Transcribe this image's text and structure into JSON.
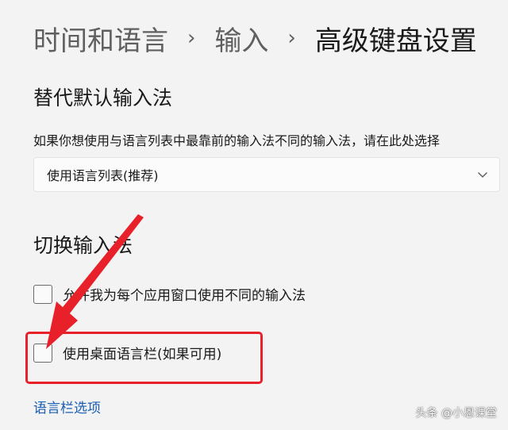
{
  "breadcrumb": {
    "items": [
      "时间和语言",
      "输入",
      "高级键盘设置"
    ],
    "separator": "›"
  },
  "override_section": {
    "title": "替代默认输入法",
    "description": "如果你想使用与语言列表中最靠前的输入法不同的输入法，请在此处选择",
    "dropdown_value": "使用语言列表(推荐)",
    "dropdown_icon": "chevron-down-icon"
  },
  "switch_section": {
    "title": "切换输入法",
    "checkbox_per_app": {
      "label": "允许我为每个应用窗口使用不同的输入法",
      "checked": false
    },
    "checkbox_language_bar": {
      "label": "使用桌面语言栏(如果可用)",
      "checked": false
    },
    "language_bar_options_link": "语言栏选项"
  },
  "annotation": {
    "color": "#e8202a"
  },
  "watermark": "头条 @小恩课堂"
}
